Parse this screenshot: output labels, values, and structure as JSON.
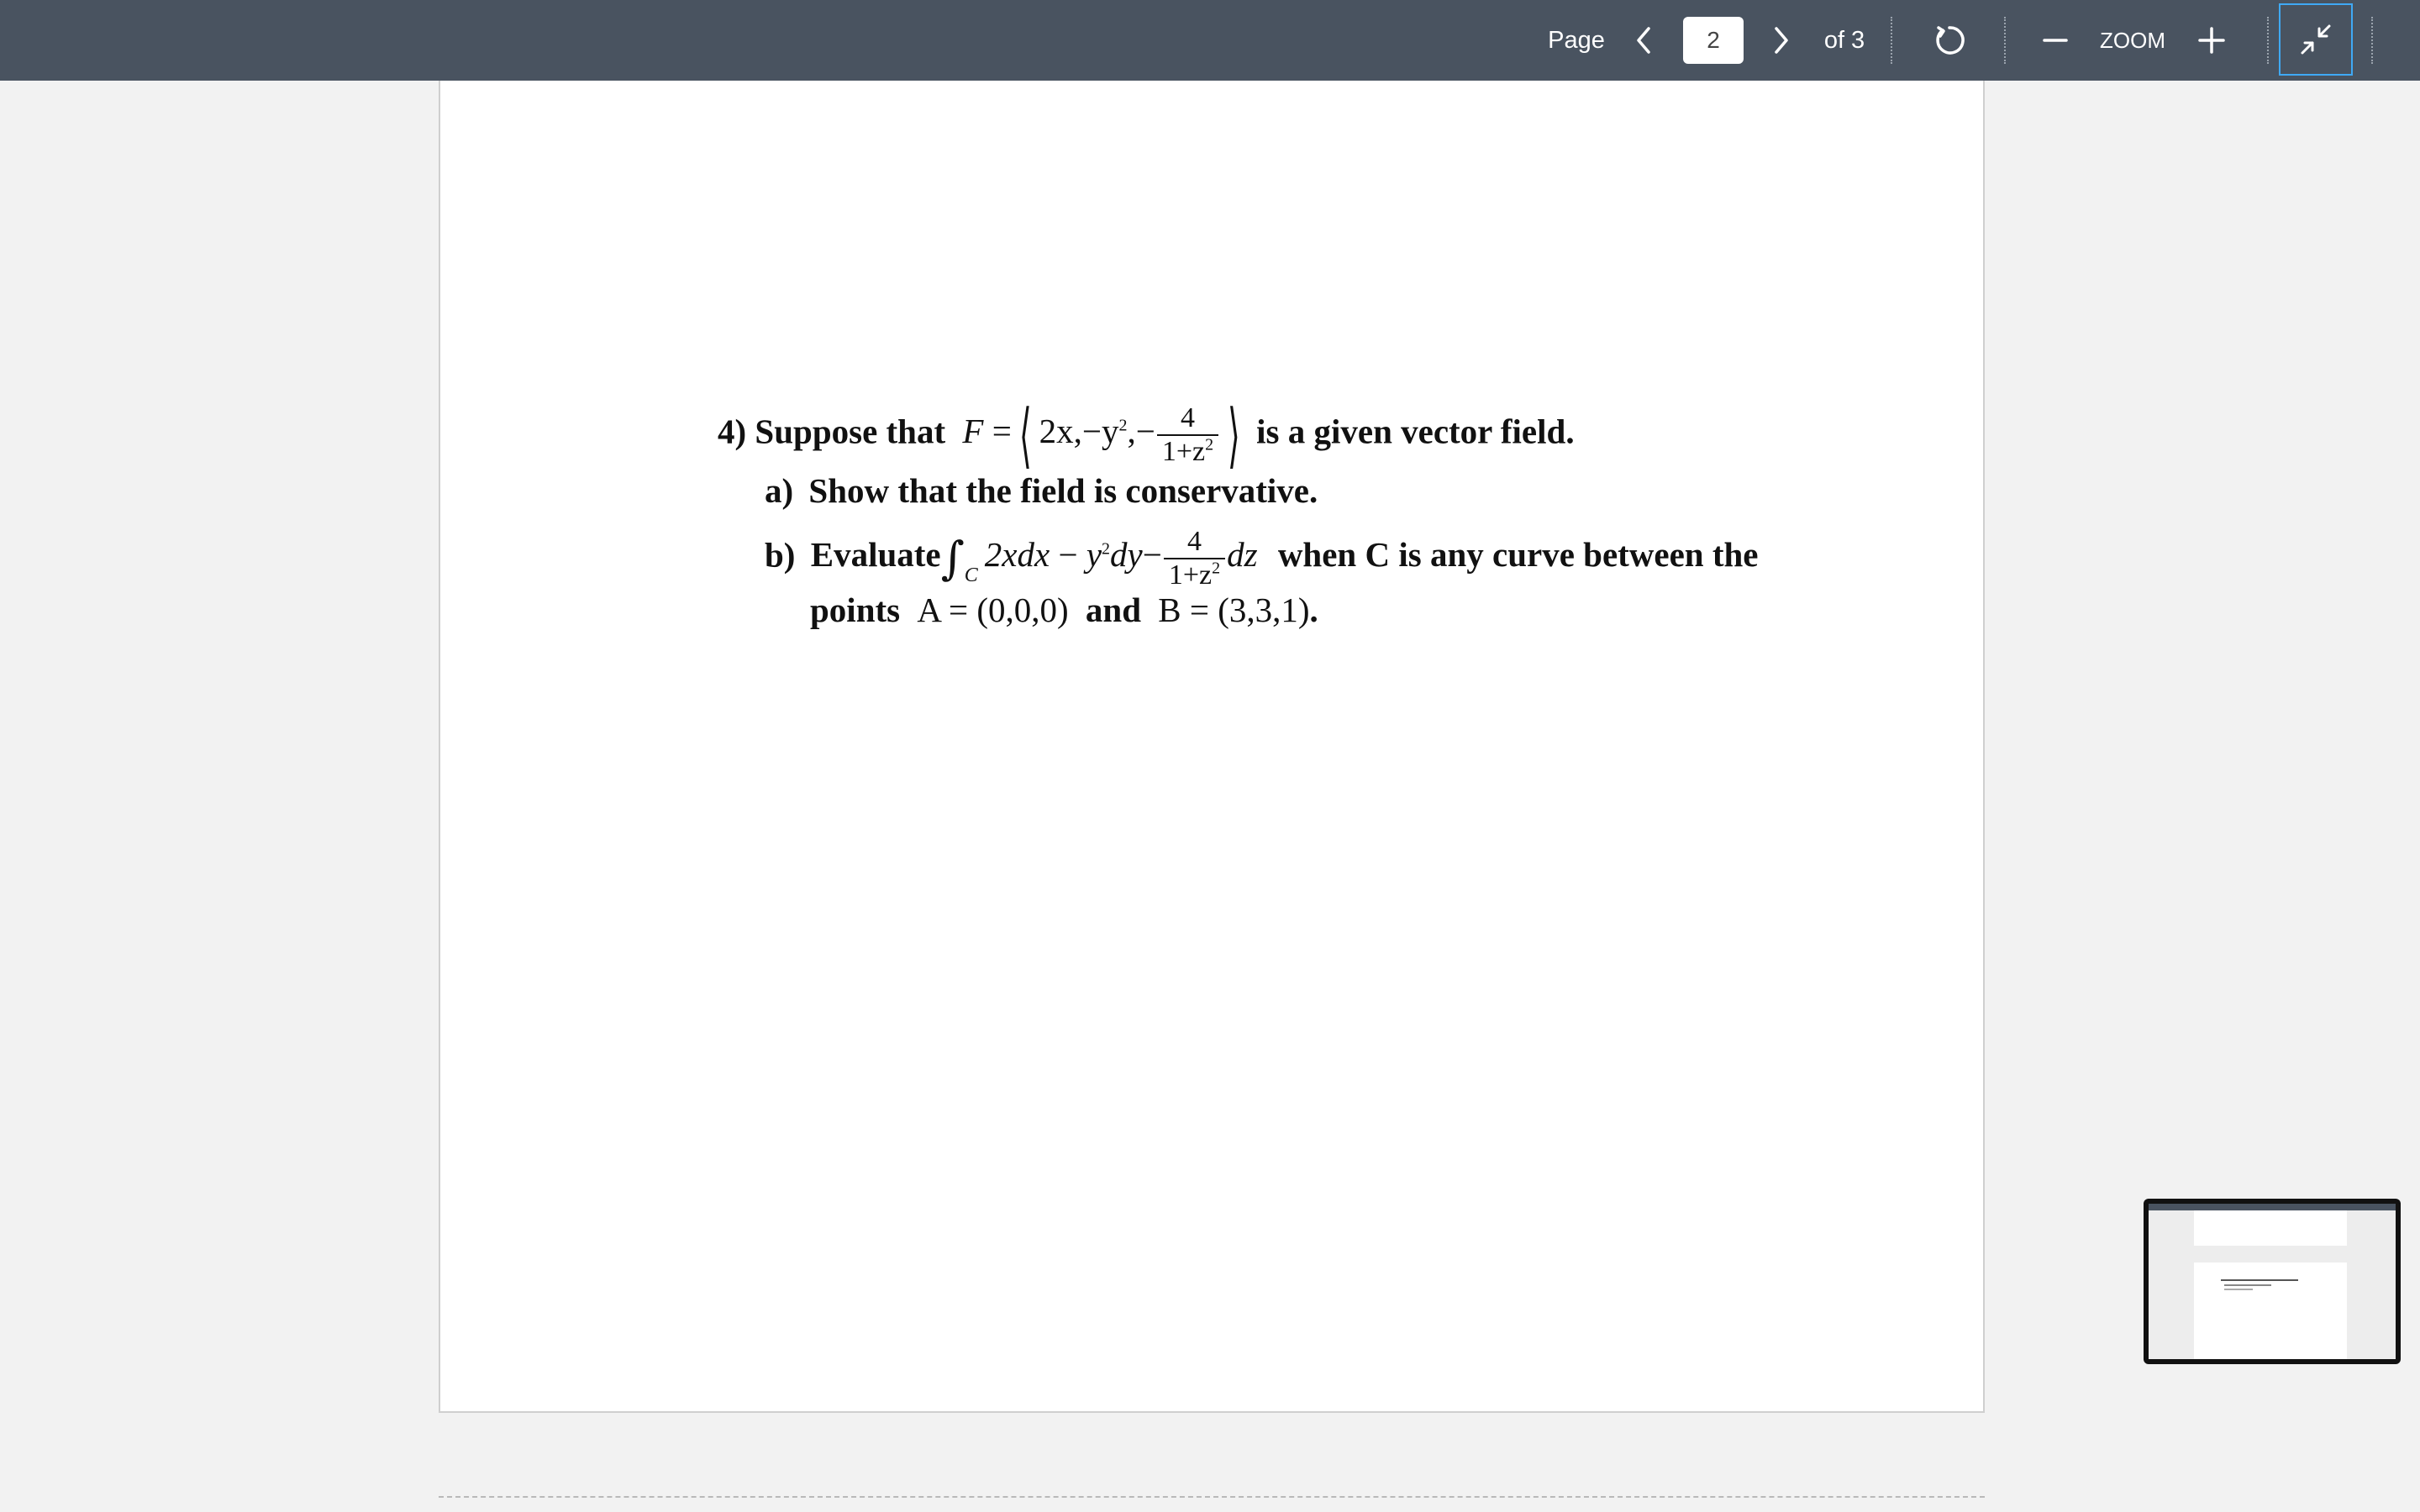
{
  "toolbar": {
    "page_label": "Page",
    "current_page": "2",
    "of_label": "of 3",
    "zoom_label": "ZOOM",
    "icons": [
      "chevron-left-icon",
      "chevron-right-icon",
      "rotate-icon",
      "zoom-out-icon",
      "zoom-in-icon",
      "collapse-icon"
    ],
    "background_color": "#495360",
    "accent_color": "#3fa9f5"
  },
  "document": {
    "problem_number": "4)",
    "intro": "Suppose that",
    "field_symbol": "F",
    "field_components": [
      "2x",
      "−y",
      "2",
      "−",
      "4",
      "1+z",
      "2"
    ],
    "field_tail": "is a given vector field.",
    "part_a_label": "a)",
    "part_a_text": "Show that the field is conservative.",
    "part_b_label": "b)",
    "part_b_text": "Evaluate",
    "integral_sub": "C",
    "integrand": [
      "2xdx",
      "−",
      "y",
      "2",
      "dy",
      "−",
      "4",
      "1+z",
      "2",
      "dz"
    ],
    "part_b_tail": "when C is any curve between the",
    "points_word": "points",
    "point_a": "A = (0,0,0)",
    "and_word": "and",
    "point_b": "B = (3,3,1)",
    "period": "."
  }
}
